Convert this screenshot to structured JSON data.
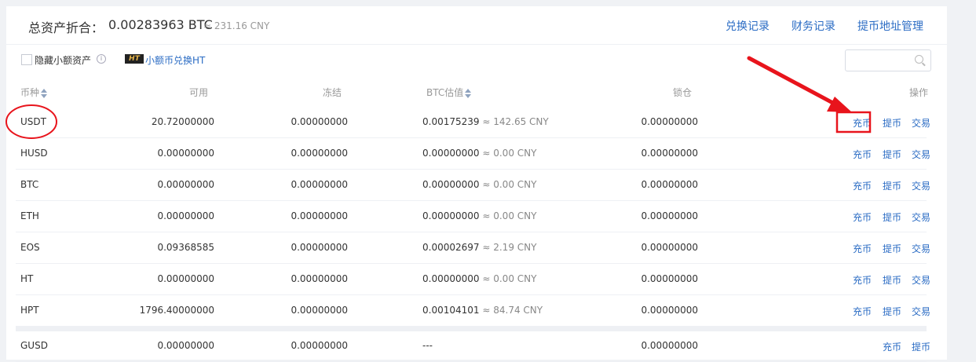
{
  "header": {
    "total_label": "总资产折合：",
    "total_btc": "0.00283963 BTC",
    "total_cny": "≈ 231.16 CNY",
    "links": [
      "兑换记录",
      "财务记录",
      "提币地址管理"
    ]
  },
  "toolbar": {
    "hide_small_label": "隐藏小额资产",
    "ht_logo_text": "HT",
    "convert_link": "小额币兑换HT",
    "search_placeholder": ""
  },
  "table": {
    "headers": {
      "coin": "币种",
      "available": "可用",
      "frozen": "冻结",
      "btc_value": "BTC估值",
      "locked": "锁仓",
      "actions": "操作"
    },
    "rows": [
      {
        "coin": "USDT",
        "available": "20.72000000",
        "frozen": "0.00000000",
        "btc": "0.00175239",
        "cny": "≈ 142.65 CNY",
        "locked": "0.00000000",
        "actions": [
          "充币",
          "提币",
          "交易"
        ]
      },
      {
        "coin": "HUSD",
        "available": "0.00000000",
        "frozen": "0.00000000",
        "btc": "0.00000000",
        "cny": "≈ 0.00 CNY",
        "locked": "0.00000000",
        "actions": [
          "充币",
          "提币",
          "交易"
        ]
      },
      {
        "coin": "BTC",
        "available": "0.00000000",
        "frozen": "0.00000000",
        "btc": "0.00000000",
        "cny": "≈ 0.00 CNY",
        "locked": "0.00000000",
        "actions": [
          "充币",
          "提币",
          "交易"
        ]
      },
      {
        "coin": "ETH",
        "available": "0.00000000",
        "frozen": "0.00000000",
        "btc": "0.00000000",
        "cny": "≈ 0.00 CNY",
        "locked": "0.00000000",
        "actions": [
          "充币",
          "提币",
          "交易"
        ]
      },
      {
        "coin": "EOS",
        "available": "0.09368585",
        "frozen": "0.00000000",
        "btc": "0.00002697",
        "cny": "≈ 2.19 CNY",
        "locked": "0.00000000",
        "actions": [
          "充币",
          "提币",
          "交易"
        ]
      },
      {
        "coin": "HT",
        "available": "0.00000000",
        "frozen": "0.00000000",
        "btc": "0.00000000",
        "cny": "≈ 0.00 CNY",
        "locked": "0.00000000",
        "actions": [
          "充币",
          "提币",
          "交易"
        ]
      },
      {
        "coin": "HPT",
        "available": "1796.40000000",
        "frozen": "0.00000000",
        "btc": "0.00104101",
        "cny": "≈ 84.74 CNY",
        "locked": "0.00000000",
        "actions": [
          "充币",
          "提币",
          "交易"
        ]
      },
      {
        "coin": "GUSD",
        "available": "0.00000000",
        "frozen": "0.00000000",
        "btc": "---",
        "cny": "",
        "locked": "0.00000000",
        "actions": [
          "充币",
          "提币"
        ]
      }
    ]
  },
  "annotation": {
    "color": "#e8141c",
    "highlight_target": "USDT 充币"
  }
}
